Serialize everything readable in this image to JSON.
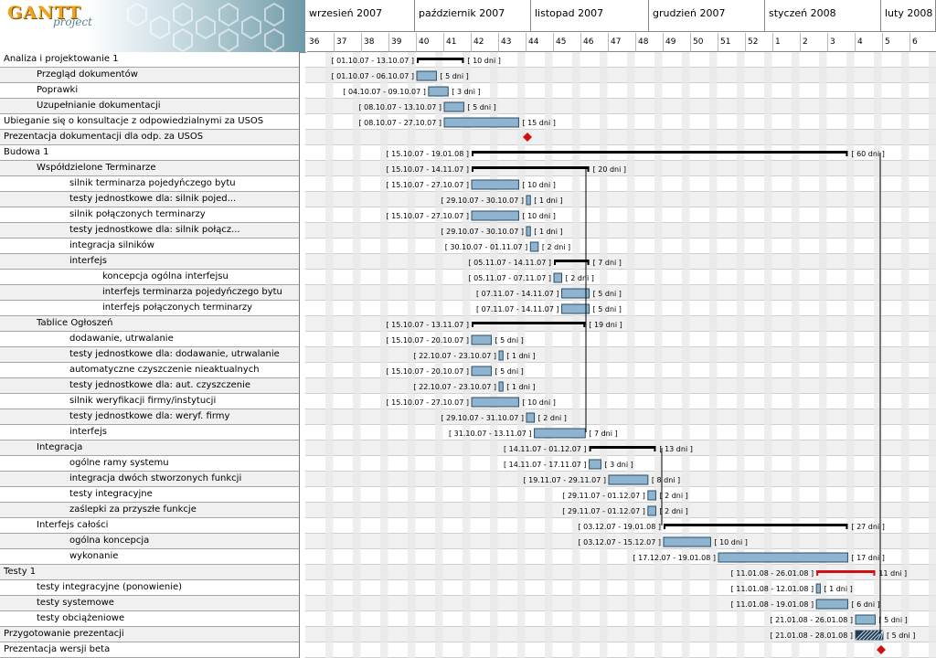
{
  "app": {
    "logo_title": "GANTT",
    "logo_subtitle": "project"
  },
  "months": [
    {
      "label": "wrzesień 2007"
    },
    {
      "label": "październik 2007"
    },
    {
      "label": "listopad 2007"
    },
    {
      "label": "grudzień 2007"
    },
    {
      "label": "styczeń 2008"
    },
    {
      "label": "luty 2008"
    }
  ],
  "weeks": [
    "36",
    "37",
    "38",
    "39",
    "40",
    "41",
    "42",
    "43",
    "44",
    "45",
    "46",
    "47",
    "48",
    "49",
    "50",
    "51",
    "52",
    "1",
    "2",
    "3",
    "4",
    "5",
    "6"
  ],
  "tasks": [
    {
      "name": "Analiza i projektowanie 1",
      "level": 0,
      "type": "summary",
      "date": "[ 01.10.07 - 13.10.07 ]",
      "dur": "[ 10 dni ]"
    },
    {
      "name": "Przegląd dokumentów",
      "level": 1,
      "type": "task",
      "date": "[ 01.10.07 - 06.10.07 ]",
      "dur": "[ 5 dni ]"
    },
    {
      "name": "Poprawki",
      "level": 1,
      "type": "task",
      "date": "[ 04.10.07 - 09.10.07 ]",
      "dur": "[ 3 dni ]"
    },
    {
      "name": "Uzupełnianie dokumentacji",
      "level": 1,
      "type": "task",
      "date": "[ 08.10.07 - 13.10.07 ]",
      "dur": "[ 5 dni ]"
    },
    {
      "name": "Ubieganie się o konsultacje z odpowiedzialnymi za USOS",
      "level": 0,
      "type": "task",
      "date": "[ 08.10.07 - 27.10.07 ]",
      "dur": "[ 15 dni ]"
    },
    {
      "name": "Prezentacja dokumentacji dla odp. za USOS",
      "level": 0,
      "type": "milestone",
      "date": "",
      "dur": ""
    },
    {
      "name": "Budowa 1",
      "level": 0,
      "type": "summary",
      "date": "[ 15.10.07 - 19.01.08 ]",
      "dur": "[ 60 dni ]"
    },
    {
      "name": "Współdzielone Terminarze",
      "level": 1,
      "type": "summary",
      "date": "[ 15.10.07 - 14.11.07 ]",
      "dur": "[ 20 dni ]"
    },
    {
      "name": "silnik terminarza pojedyńczego bytu",
      "level": 2,
      "type": "task",
      "date": "[ 15.10.07 - 27.10.07 ]",
      "dur": "[ 10 dni ]"
    },
    {
      "name": "testy jednostkowe dla: silnik pojed...",
      "level": 2,
      "type": "task",
      "date": "[ 29.10.07 - 30.10.07 ]",
      "dur": "[ 1 dni ]"
    },
    {
      "name": "silnik połączonych terminarzy",
      "level": 2,
      "type": "task",
      "date": "[ 15.10.07 - 27.10.07 ]",
      "dur": "[ 10 dni ]"
    },
    {
      "name": "testy jednostkowe dla: silnik połącz...",
      "level": 2,
      "type": "task",
      "date": "[ 29.10.07 - 30.10.07 ]",
      "dur": "[ 1 dni ]"
    },
    {
      "name": "integracja silników",
      "level": 2,
      "type": "task",
      "date": "[ 30.10.07 - 01.11.07 ]",
      "dur": "[ 2 dni ]"
    },
    {
      "name": "interfejs",
      "level": 2,
      "type": "summary",
      "date": "[ 05.11.07 - 14.11.07 ]",
      "dur": "[ 7 dni ]"
    },
    {
      "name": "koncepcja ogólna interfejsu",
      "level": 3,
      "type": "task",
      "date": "[ 05.11.07 - 07.11.07 ]",
      "dur": "[ 2 dni ]"
    },
    {
      "name": "interfejs terminarza pojedyńczego bytu",
      "level": 3,
      "type": "task",
      "date": "[ 07.11.07 - 14.11.07 ]",
      "dur": "[ 5 dni ]"
    },
    {
      "name": "interfejs połączonych terminarzy",
      "level": 3,
      "type": "task",
      "date": "[ 07.11.07 - 14.11.07 ]",
      "dur": "[ 5 dni ]"
    },
    {
      "name": "Tablice Ogłoszeń",
      "level": 1,
      "type": "summary",
      "date": "[ 15.10.07 - 13.11.07 ]",
      "dur": "[ 19 dni ]"
    },
    {
      "name": "dodawanie, utrwalanie",
      "level": 2,
      "type": "task",
      "date": "[ 15.10.07 - 20.10.07 ]",
      "dur": "[ 5 dni ]"
    },
    {
      "name": "testy jednostkowe dla: dodawanie, utrwalanie",
      "level": 2,
      "type": "task",
      "date": "[ 22.10.07 - 23.10.07 ]",
      "dur": "[ 1 dni ]"
    },
    {
      "name": "automatyczne czyszczenie nieaktualnych",
      "level": 2,
      "type": "task",
      "date": "[ 15.10.07 - 20.10.07 ]",
      "dur": "[ 5 dni ]"
    },
    {
      "name": "testy jednostkowe dla: aut. czyszczenie",
      "level": 2,
      "type": "task",
      "date": "[ 22.10.07 - 23.10.07 ]",
      "dur": "[ 1 dni ]"
    },
    {
      "name": "silnik weryfikacji firmy/instytucji",
      "level": 2,
      "type": "task",
      "date": "[ 15.10.07 - 27.10.07 ]",
      "dur": "[ 10 dni ]"
    },
    {
      "name": "testy jednostkowe dla: weryf. firmy",
      "level": 2,
      "type": "task",
      "date": "[ 29.10.07 - 31.10.07 ]",
      "dur": "[ 2 dni ]"
    },
    {
      "name": "interfejs",
      "level": 2,
      "type": "task",
      "date": "[ 31.10.07 - 13.11.07 ]",
      "dur": "[ 7 dni ]"
    },
    {
      "name": "Integracja",
      "level": 1,
      "type": "summary",
      "date": "[ 14.11.07 - 01.12.07 ]",
      "dur": "[ 13 dni ]"
    },
    {
      "name": "ogólne ramy systemu",
      "level": 2,
      "type": "task",
      "date": "[ 14.11.07 - 17.11.07 ]",
      "dur": "[ 3 dni ]"
    },
    {
      "name": "integracja dwóch stworzonych funkcji",
      "level": 2,
      "type": "task",
      "date": "[ 19.11.07 - 29.11.07 ]",
      "dur": "[ 8 dni ]"
    },
    {
      "name": "testy integracyjne",
      "level": 2,
      "type": "task",
      "date": "[ 29.11.07 - 01.12.07 ]",
      "dur": "[ 2 dni ]"
    },
    {
      "name": "zaślepki za przyszłe funkcje",
      "level": 2,
      "type": "task",
      "date": "[ 29.11.07 - 01.12.07 ]",
      "dur": "[ 2 dni ]"
    },
    {
      "name": "Interfejs całości",
      "level": 1,
      "type": "summary",
      "date": "[ 03.12.07 - 19.01.08 ]",
      "dur": "[ 27 dni ]"
    },
    {
      "name": "ogólna koncepcja",
      "level": 2,
      "type": "task",
      "date": "[ 03.12.07 - 15.12.07 ]",
      "dur": "[ 10 dni ]"
    },
    {
      "name": "wykonanie",
      "level": 2,
      "type": "task",
      "date": "[ 17.12.07 - 19.01.08 ]",
      "dur": "[ 17 dni ]"
    },
    {
      "name": "Testy 1",
      "level": 0,
      "type": "summary-red",
      "date": "[ 11.01.08 - 26.01.08 ]",
      "dur": "11 dni ]"
    },
    {
      "name": "testy integracyjne (ponowienie)",
      "level": 1,
      "type": "task",
      "date": "[ 11.01.08 - 12.01.08 ]",
      "dur": "[ 1 dni ]"
    },
    {
      "name": "testy systemowe",
      "level": 1,
      "type": "task",
      "date": "[ 11.01.08 - 19.01.08 ]",
      "dur": "[ 6 dni ]"
    },
    {
      "name": "testy obciążeniowe",
      "level": 1,
      "type": "task",
      "date": "[ 21.01.08 - 26.01.08 ]",
      "dur": "[ 5 dni ]"
    },
    {
      "name": "Przygotowanie prezentacji",
      "level": 0,
      "type": "task-hatch",
      "date": "[ 21.01.08 - 28.01.08 ]",
      "dur": "[ 5 dni ]"
    },
    {
      "name": "Prezentacja wersji beta",
      "level": 0,
      "type": "milestone",
      "date": "",
      "dur": ""
    }
  ],
  "colors": {
    "bar": "#8eb4cf",
    "bar_border": "#2a4d66",
    "summary": "#000000",
    "critical": "#d01010",
    "milestone": "#d01010",
    "weekend": "#e8e8e8",
    "row_alt": "#f0f0f0"
  }
}
